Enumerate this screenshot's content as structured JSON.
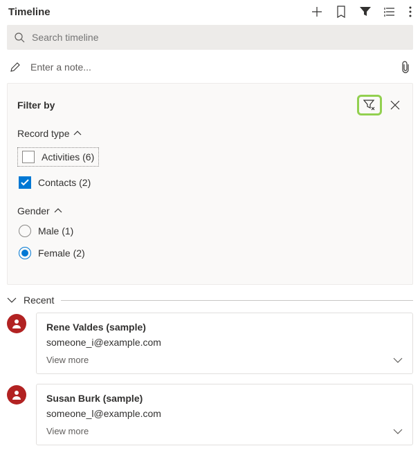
{
  "header": {
    "title": "Timeline"
  },
  "search": {
    "placeholder": "Search timeline"
  },
  "note": {
    "placeholder": "Enter a note..."
  },
  "filter": {
    "title": "Filter by",
    "groups": {
      "recordType": {
        "label": "Record type",
        "options": {
          "activities": {
            "label": "Activities (6)",
            "checked": false
          },
          "contacts": {
            "label": "Contacts (2)",
            "checked": true
          }
        }
      },
      "gender": {
        "label": "Gender",
        "options": {
          "male": {
            "label": "Male (1)",
            "selected": false
          },
          "female": {
            "label": "Female (2)",
            "selected": true
          }
        }
      }
    }
  },
  "section": {
    "recent": "Recent"
  },
  "records": [
    {
      "name": "Rene Valdes (sample)",
      "email": "someone_i@example.com",
      "more": "View more"
    },
    {
      "name": "Susan Burk (sample)",
      "email": "someone_l@example.com",
      "more": "View more"
    }
  ]
}
